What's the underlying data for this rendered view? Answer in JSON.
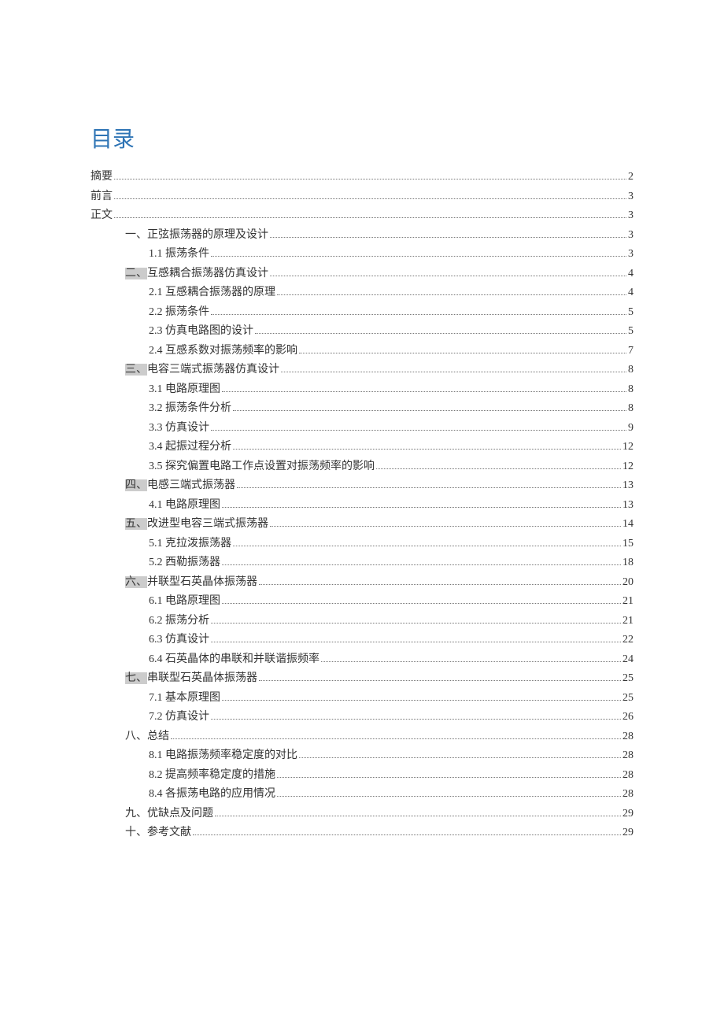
{
  "title": "目录",
  "entries": [
    {
      "level": 0,
      "label": "摘要",
      "page": "2",
      "highlight": false
    },
    {
      "level": 0,
      "label": "前言",
      "page": "3",
      "highlight": false
    },
    {
      "level": 0,
      "label": "正文",
      "page": "3",
      "highlight": false
    },
    {
      "level": 1,
      "label": "一、正弦振荡器的原理及设计",
      "page": "3",
      "highlight": false
    },
    {
      "level": 2,
      "label": "1.1 振荡条件",
      "page": "3",
      "highlight": false
    },
    {
      "level": 1,
      "label": "二、互感耦合振荡器仿真设计",
      "page": "4",
      "highlight": true,
      "highlightPrefix": "二、"
    },
    {
      "level": 2,
      "label": "2.1 互感耦合振荡器的原理",
      "page": "4",
      "highlight": false
    },
    {
      "level": 2,
      "label": "2.2 振荡条件",
      "page": "5",
      "highlight": false
    },
    {
      "level": 2,
      "label": "2.3 仿真电路图的设计",
      "page": "5",
      "highlight": false
    },
    {
      "level": 2,
      "label": "2.4 互感系数对振荡频率的影响",
      "page": "7",
      "highlight": false
    },
    {
      "level": 1,
      "label": "三、电容三端式振荡器仿真设计",
      "page": "8",
      "highlight": true,
      "highlightPrefix": "三、"
    },
    {
      "level": 2,
      "label": "3.1 电路原理图",
      "page": "8",
      "highlight": false
    },
    {
      "level": 2,
      "label": "3.2 振荡条件分析",
      "page": "8",
      "highlight": false
    },
    {
      "level": 2,
      "label": "3.3 仿真设计",
      "page": "9",
      "highlight": false
    },
    {
      "level": 2,
      "label": "3.4 起振过程分析",
      "page": "12",
      "highlight": false
    },
    {
      "level": 2,
      "label": "3.5 探究偏置电路工作点设置对振荡频率的影响",
      "page": "12",
      "highlight": false
    },
    {
      "level": 1,
      "label": "四、电感三端式振荡器",
      "page": "13",
      "highlight": true,
      "highlightPrefix": "四、"
    },
    {
      "level": 2,
      "label": "4.1 电路原理图",
      "page": "13",
      "highlight": false
    },
    {
      "level": 1,
      "label": "五、改进型电容三端式振荡器",
      "page": "14",
      "highlight": true,
      "highlightPrefix": "五、"
    },
    {
      "level": 2,
      "label": "5.1 克拉泼振荡器",
      "page": "15",
      "highlight": false
    },
    {
      "level": 2,
      "label": "5.2 西勒振荡器",
      "page": "18",
      "highlight": false
    },
    {
      "level": 1,
      "label": "六、并联型石英晶体振荡器",
      "page": "20",
      "highlight": true,
      "highlightPrefix": "六、"
    },
    {
      "level": 2,
      "label": "6.1 电路原理图",
      "page": "21",
      "highlight": false
    },
    {
      "level": 2,
      "label": "6.2 振荡分析",
      "page": "21",
      "highlight": false
    },
    {
      "level": 2,
      "label": "6.3 仿真设计",
      "page": "22",
      "highlight": false
    },
    {
      "level": 2,
      "label": "6.4 石英晶体的串联和并联谐振频率",
      "page": "24",
      "highlight": false
    },
    {
      "level": 1,
      "label": "七、串联型石英晶体振荡器",
      "page": "25",
      "highlight": true,
      "highlightPrefix": "七、"
    },
    {
      "level": 2,
      "label": "7.1 基本原理图",
      "page": "25",
      "highlight": false
    },
    {
      "level": 2,
      "label": "7.2 仿真设计",
      "page": "26",
      "highlight": false
    },
    {
      "level": 1,
      "label": "八、总结",
      "page": "28",
      "highlight": false
    },
    {
      "level": 2,
      "label": "8.1 电路振荡频率稳定度的对比",
      "page": "28",
      "highlight": false
    },
    {
      "level": 2,
      "label": "8.2 提高频率稳定度的措施",
      "page": "28",
      "highlight": false
    },
    {
      "level": 2,
      "label": "8.4 各振荡电路的应用情况",
      "page": "28",
      "highlight": false
    },
    {
      "level": 1,
      "label": "九、优缺点及问题",
      "page": "29",
      "highlight": false
    },
    {
      "level": 1,
      "label": "十、参考文献",
      "page": "29",
      "highlight": false
    }
  ]
}
